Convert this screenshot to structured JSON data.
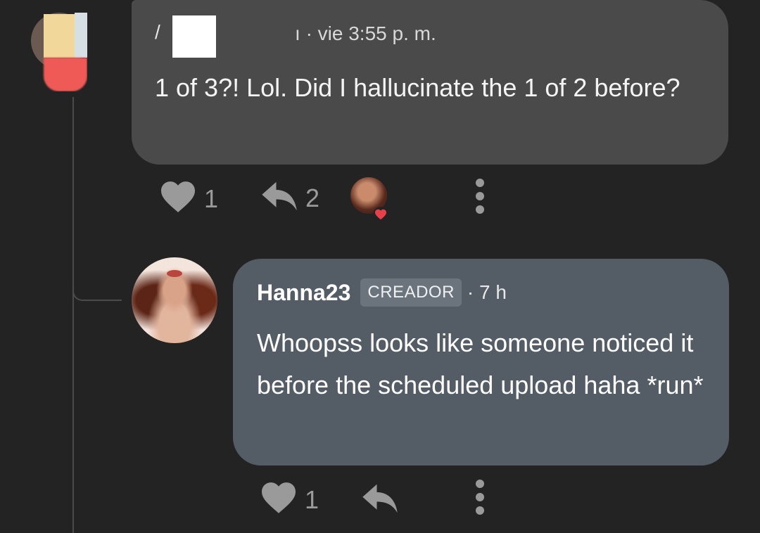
{
  "comment1": {
    "author": "/",
    "author_suffix": "ı",
    "meta": "· vie 3:55 p. m.",
    "text": "1 of 3?!  Lol. Did I hallucinate the 1 of 2 before?",
    "likes": "1",
    "replies": "2",
    "icons": {
      "like": "heart-icon",
      "reply": "reply-arrow-icon",
      "more": "more-vertical-icon"
    }
  },
  "comment2": {
    "author": "Hanna23",
    "badge": "CREADOR",
    "meta": "· 7 h",
    "text": "Whoopss looks like someone noticed it before the scheduled upload haha *run*",
    "likes": "1",
    "icons": {
      "like": "heart-icon",
      "reply": "reply-arrow-icon",
      "more": "more-vertical-icon"
    }
  },
  "colors": {
    "background": "#232323",
    "bubble_user": "#4a4a4a",
    "bubble_creator": "#545d66",
    "icon_gray": "#9a9a9a",
    "heart_red": "#e8404a"
  }
}
